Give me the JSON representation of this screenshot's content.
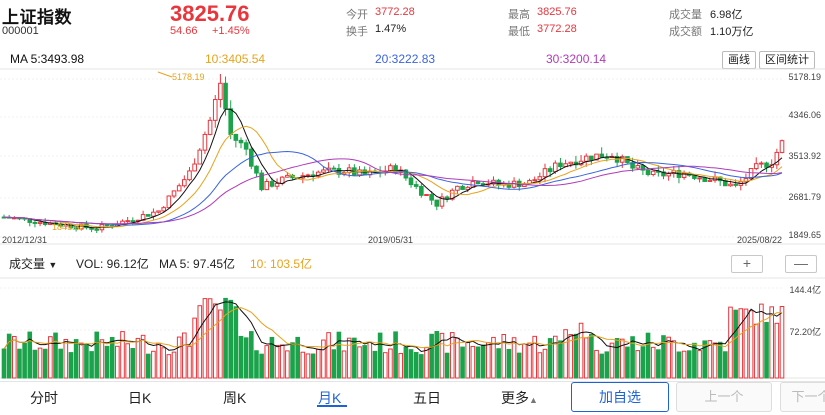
{
  "header": {
    "name": "上证指数",
    "code": "000001",
    "price": "3825.76",
    "change": "54.66",
    "change_pct": "+1.45%",
    "open_label": "今开",
    "open_value": "3772.28",
    "turnover_label": "换手",
    "turnover_value": "1.47%",
    "high_label": "最高",
    "high_value": "3825.76",
    "low_label": "最低",
    "low_value": "3772.28",
    "volume_label": "成交量",
    "volume_value": "6.98亿",
    "amount_label": "成交额",
    "amount_value": "1.10万亿"
  },
  "ma_legend": {
    "ma5": "MA 5:3493.98",
    "ma10": "10:3405.54",
    "ma20": "20:3222.83",
    "ma30": "30:3200.14"
  },
  "tools": {
    "draw": "画线",
    "stats": "区间统计"
  },
  "price_axis": [
    "5178.19",
    "4346.06",
    "3513.92",
    "2681.79",
    "1849.65"
  ],
  "annotations": {
    "max": "5178.19",
    "min": "1849.65"
  },
  "dates": [
    "2012/12/31",
    "2019/05/31",
    "2025/08/22"
  ],
  "volume_bar": {
    "indicator": "成交量",
    "vol": "VOL: 96.12亿",
    "ma5": "MA 5: 97.45亿",
    "ma10": "10: 103.5亿",
    "zoom_in": "+",
    "zoom_out": "—"
  },
  "volume_axis": [
    "144.4亿",
    "72.20亿"
  ],
  "tabs": [
    "分时",
    "日K",
    "周K",
    "月K",
    "五日",
    "更多"
  ],
  "active_tab": "月K",
  "more_arrow": "▲",
  "actions": {
    "add": "加自选",
    "prev": "上一个",
    "next": "下一个"
  },
  "colors": {
    "up": "#e8363c",
    "down": "#1aa34a",
    "ma5": "#111111",
    "ma10": "#e8a31c",
    "ma20": "#3a64e0",
    "ma30": "#b03ab8",
    "accent": "#1e63d6"
  }
}
